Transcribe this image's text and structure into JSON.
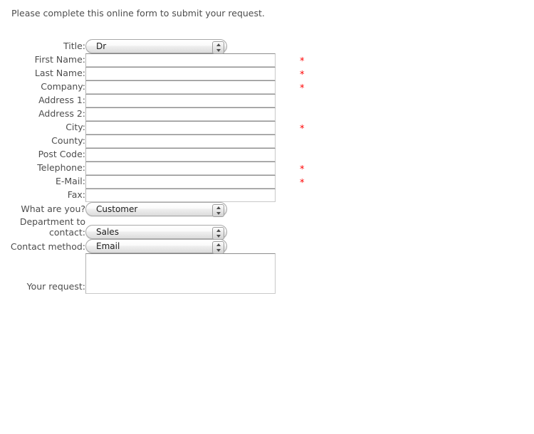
{
  "intro": {
    "text": "Please complete this online form to submit your request."
  },
  "required_marker": "*",
  "colors": {
    "required": "#ff0000",
    "label_text": "#4d4d4d",
    "input_border": "#c9c9c9",
    "input_border_top": "#8d8d8d",
    "select_border": "#a8a8a8"
  },
  "form": {
    "rows": [
      {
        "label": "Title:",
        "type": "select",
        "value": "Dr",
        "required": false,
        "name": "title"
      },
      {
        "label": "First Name:",
        "type": "text",
        "value": "",
        "required": true,
        "name": "first-name"
      },
      {
        "label": "Last Name:",
        "type": "text",
        "value": "",
        "required": true,
        "name": "last-name"
      },
      {
        "label": "Company:",
        "type": "text",
        "value": "",
        "required": true,
        "name": "company"
      },
      {
        "label": "Address 1:",
        "type": "text",
        "value": "",
        "required": false,
        "name": "address-1"
      },
      {
        "label": "Address 2:",
        "type": "text",
        "value": "",
        "required": false,
        "name": "address-2"
      },
      {
        "label": "City:",
        "type": "text",
        "value": "",
        "required": true,
        "name": "city"
      },
      {
        "label": "County:",
        "type": "text",
        "value": "",
        "required": false,
        "name": "county"
      },
      {
        "label": "Post Code:",
        "type": "text",
        "value": "",
        "required": false,
        "name": "post-code"
      },
      {
        "label": "Telephone:",
        "type": "text",
        "value": "",
        "required": true,
        "name": "telephone"
      },
      {
        "label": "E-Mail:",
        "type": "text",
        "value": "",
        "required": true,
        "name": "email"
      },
      {
        "label": "Fax:",
        "type": "text",
        "value": "",
        "required": false,
        "name": "fax"
      },
      {
        "label": "What are you?",
        "type": "select",
        "value": "Customer",
        "required": false,
        "name": "what-are-you"
      },
      {
        "label": "Department to contact:",
        "type": "select",
        "value": "Sales",
        "required": false,
        "name": "department-to-contact"
      },
      {
        "label": "Contact method:",
        "type": "select",
        "value": "Email",
        "required": false,
        "name": "contact-method"
      },
      {
        "label": "Your request:",
        "type": "textarea",
        "value": "",
        "required": false,
        "name": "your-request"
      }
    ]
  }
}
